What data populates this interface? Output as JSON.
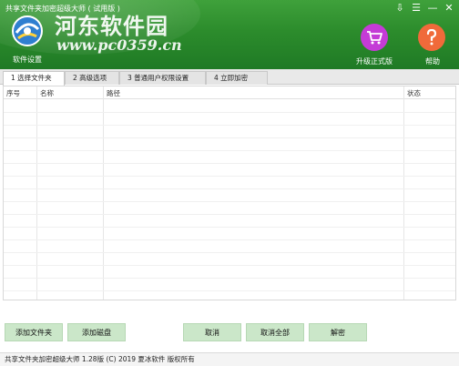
{
  "window": {
    "title": "共享文件夹加密超级大师 ( 试用版 )",
    "controls": [
      "⇩",
      "☰",
      "—",
      "✕"
    ]
  },
  "header": {
    "watermark": "河东软件园",
    "watermark_url": "www.pc0359.cn",
    "settings_label": "软件设置",
    "upgrade_label": "升级正式版",
    "help_label": "帮助",
    "upgrade_icon": "cart-icon",
    "help_icon": "question-icon",
    "colors": {
      "header_green": "#2c8c2c",
      "upgrade_purple": "#c43bd6",
      "help_orange": "#f06a3a"
    }
  },
  "tabs": [
    {
      "label": "1 选择文件夹",
      "active": true
    },
    {
      "label": "2 高级选项",
      "active": false
    },
    {
      "label": "3 普通用户权限设置",
      "active": false
    },
    {
      "label": "4 立即加密",
      "active": false
    }
  ],
  "table": {
    "columns": [
      "序号",
      "名称",
      "路径",
      "状态"
    ],
    "rows": []
  },
  "buttons": {
    "add_folder": "添加文件夹",
    "add_disk": "添加磁盘",
    "cancel": "取消",
    "cancel_all": "取消全部",
    "decrypt": "解密"
  },
  "status_bar": {
    "text": "共享文件夹加密超级大师  1.28版  (C) 2019  夏冰软件 版权所有"
  }
}
